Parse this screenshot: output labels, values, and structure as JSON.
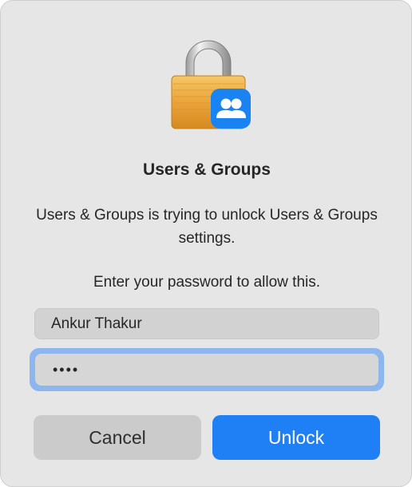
{
  "dialog": {
    "icon": "lock-with-users-icon",
    "badge_icon": "users-groups-icon",
    "title": "Users & Groups",
    "message": "Users & Groups is trying to unlock Users & Groups settings.",
    "prompt": "Enter your password to allow this.",
    "username_value": "Ankur Thakur",
    "password_value": "••••",
    "cancel_label": "Cancel",
    "unlock_label": "Unlock"
  },
  "colors": {
    "accent": "#1f7ff5",
    "focus_ring": "#8db5ee",
    "lock_gold": "#e8a53c"
  }
}
